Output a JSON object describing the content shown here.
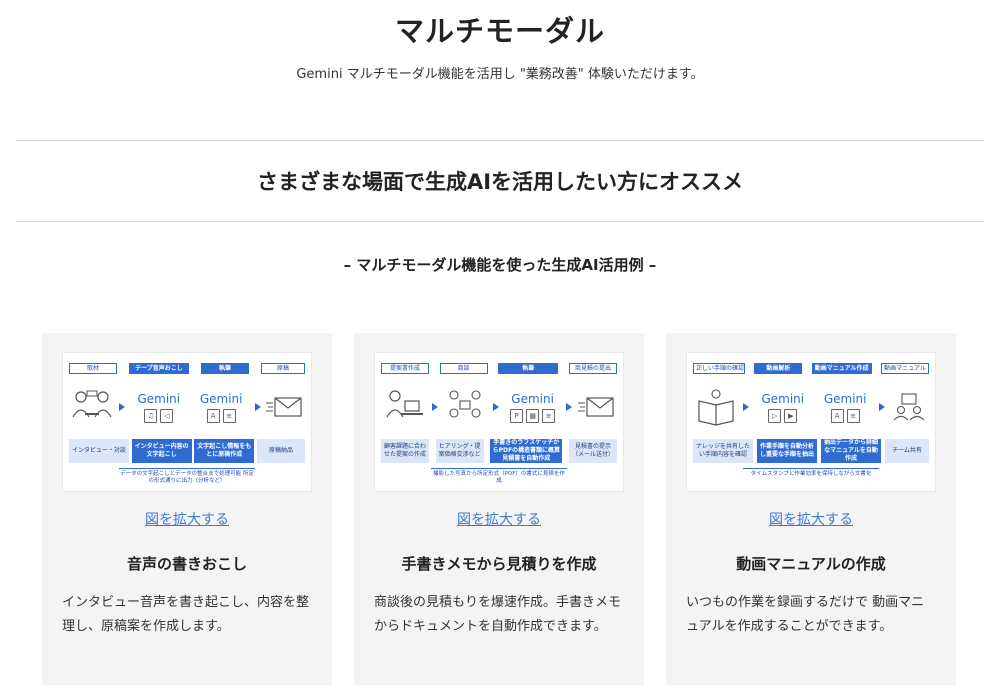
{
  "header": {
    "title": "マルチモーダル",
    "subtitle": "Gemini マルチモーダル機能を活用し \"業務改善\" 体験いただけます。"
  },
  "section": {
    "heading": "さまざまな場面で生成AIを活用したい方にオススメ",
    "examples_heading": "– マルチモーダル機能を使った生成AI活用例 –"
  },
  "cards": [
    {
      "figure": {
        "steps": [
          "取材",
          "テープ音声おこし",
          "執筆",
          "原稿"
        ],
        "gemini": "Gemini",
        "boxes": [
          "インタビュー・対談",
          "インタビュー内容の文字起こし",
          "文字起こし情報をもとに原稿作成",
          "原稿納品"
        ],
        "note": "データの文字起こしとデータの整合まで処理可能 所定の形式通りに出力（分析など）"
      },
      "link": "図を拡大する",
      "title": "音声の書きおこし",
      "description": "インタビュー音声を書き起こし、内容を整理し、原稿案を作成します。"
    },
    {
      "figure": {
        "steps": [
          "提案書作成",
          "商談",
          "執筆",
          "商見積の提出"
        ],
        "gemini": "Gemini",
        "boxes": [
          "顧客課題に合わせた提案の作成",
          "ヒアリング・提案価格交渉など",
          "手書きのラフスケッチからPDFの構造書類に概算見積書を自動作成",
          "見積書の提示（メール送付）"
        ],
        "note": "撮影した写真から所定形式（PDF）の書式に見積を作成"
      },
      "link": "図を拡大する",
      "title": "手書きメモから見積りを作成",
      "description": "商談後の見積もりを爆速作成。手書きメモからドキュメントを自動作成できます。"
    },
    {
      "figure": {
        "steps": [
          "正しい手順の確認",
          "動画解析",
          "動画マニュアル作成",
          "動画マニュアル"
        ],
        "gemini": "Gemini",
        "boxes": [
          "ナレッジを共有したい手順内容を確認",
          "作業手順を自動分析し重要な手順を抽出",
          "抽出データから詳細なマニュアルを自動作成",
          "チーム共有"
        ],
        "note": "タイムスタンプと作業効率を保持しながら文書化"
      },
      "link": "図を拡大する",
      "title": "動画マニュアルの作成",
      "description": "いつもの作業を録画するだけで 動画マニュアルを作成することができます。"
    }
  ]
}
